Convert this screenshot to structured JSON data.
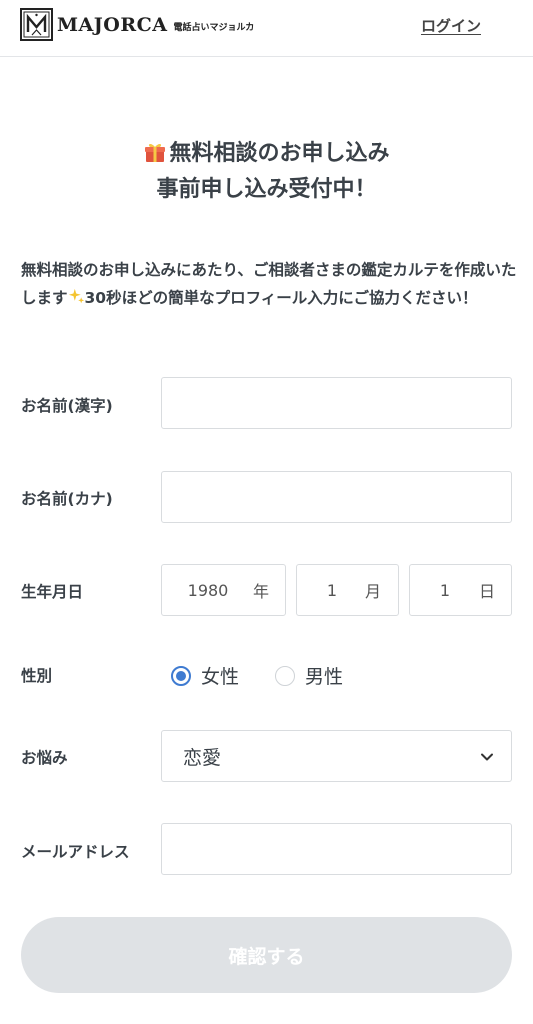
{
  "header": {
    "brand": "MAJORCA",
    "brand_sub": "電話占いマジョルカ",
    "login_label": "ログイン"
  },
  "headline": {
    "line1": "無料相談のお申し込み",
    "line2": "事前申し込み受付中！",
    "icon": "gift-icon"
  },
  "intro": {
    "part1": "無料相談のお申し込みにあたり、ご相談者さまの鑑定カルテを作成いたします",
    "part2": "30秒ほどの簡単なプロフィール入力にご協力ください！",
    "icon": "sparkle-icon"
  },
  "form": {
    "name_kanji_label": "お名前(漢字)",
    "name_kanji_value": "",
    "name_kana_label": "お名前(カナ)",
    "name_kana_value": "",
    "birth_label": "生年月日",
    "birth_year": "1980",
    "birth_year_unit": "年",
    "birth_month": "1",
    "birth_month_unit": "月",
    "birth_day": "1",
    "birth_day_unit": "日",
    "gender_label": "性別",
    "gender_female": "女性",
    "gender_male": "男性",
    "gender_selected": "女性",
    "concern_label": "お悩み",
    "concern_value": "恋愛",
    "email_label": "メールアドレス",
    "email_value": "",
    "confirm_label": "確認する"
  },
  "colors": {
    "accent": "#3f7bd1",
    "button_disabled": "#dfe2e5",
    "text": "#3a4148",
    "border": "#d9dcdf"
  }
}
